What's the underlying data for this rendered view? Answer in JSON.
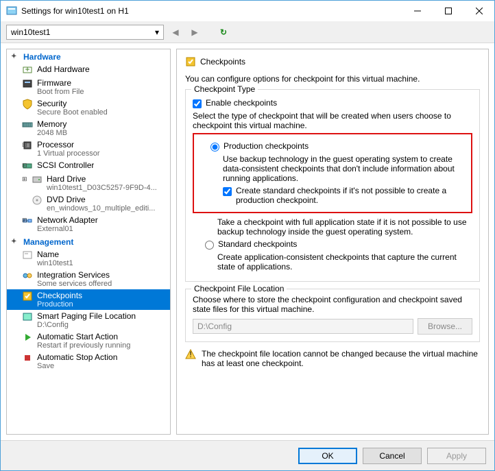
{
  "window": {
    "title": "Settings for win10test1 on H1"
  },
  "toolbar": {
    "vm": "win10test1"
  },
  "tree": {
    "hardware_header": "Hardware",
    "management_header": "Management",
    "hardware": [
      {
        "label": "Add Hardware",
        "sub": ""
      },
      {
        "label": "Firmware",
        "sub": "Boot from File"
      },
      {
        "label": "Security",
        "sub": "Secure Boot enabled"
      },
      {
        "label": "Memory",
        "sub": "2048 MB"
      },
      {
        "label": "Processor",
        "sub": "1 Virtual processor"
      },
      {
        "label": "SCSI Controller",
        "sub": ""
      },
      {
        "label": "Hard Drive",
        "sub": "win10test1_D03C5257-9F9D-4..."
      },
      {
        "label": "DVD Drive",
        "sub": "en_windows_10_multiple_editi..."
      },
      {
        "label": "Network Adapter",
        "sub": "External01"
      }
    ],
    "management": [
      {
        "label": "Name",
        "sub": "win10test1"
      },
      {
        "label": "Integration Services",
        "sub": "Some services offered"
      },
      {
        "label": "Checkpoints",
        "sub": "Production"
      },
      {
        "label": "Smart Paging File Location",
        "sub": "D:\\Config"
      },
      {
        "label": "Automatic Start Action",
        "sub": "Restart if previously running"
      },
      {
        "label": "Automatic Stop Action",
        "sub": "Save"
      }
    ]
  },
  "pane": {
    "title": "Checkpoints",
    "intro": "You can configure options for checkpoint for this virtual machine.",
    "ct_title": "Checkpoint Type",
    "enable": "Enable checkpoints",
    "select_type": "Select the type of checkpoint that will be created when users choose to checkpoint this virtual machine.",
    "prod": "Production checkpoints",
    "prod_desc": "Use backup technology in the guest operating system to create data-consistent checkpoints that don't include information about running applications.",
    "fallback": "Create standard checkpoints if it's not possible to create a production checkpoint.",
    "take_desc": "Take a checkpoint with full application state if it is not possible to use backup technology inside the guest operating system.",
    "std": "Standard checkpoints",
    "std_desc": "Create application-consistent checkpoints that capture the current state of applications.",
    "loc_title": "Checkpoint File Location",
    "loc_desc": "Choose where to store the checkpoint configuration and checkpoint saved state files for this virtual machine.",
    "loc_path": "D:\\Config",
    "browse": "Browse...",
    "warn": "The checkpoint file location cannot be changed because the virtual machine has at least one checkpoint."
  },
  "footer": {
    "ok": "OK",
    "cancel": "Cancel",
    "apply": "Apply"
  }
}
